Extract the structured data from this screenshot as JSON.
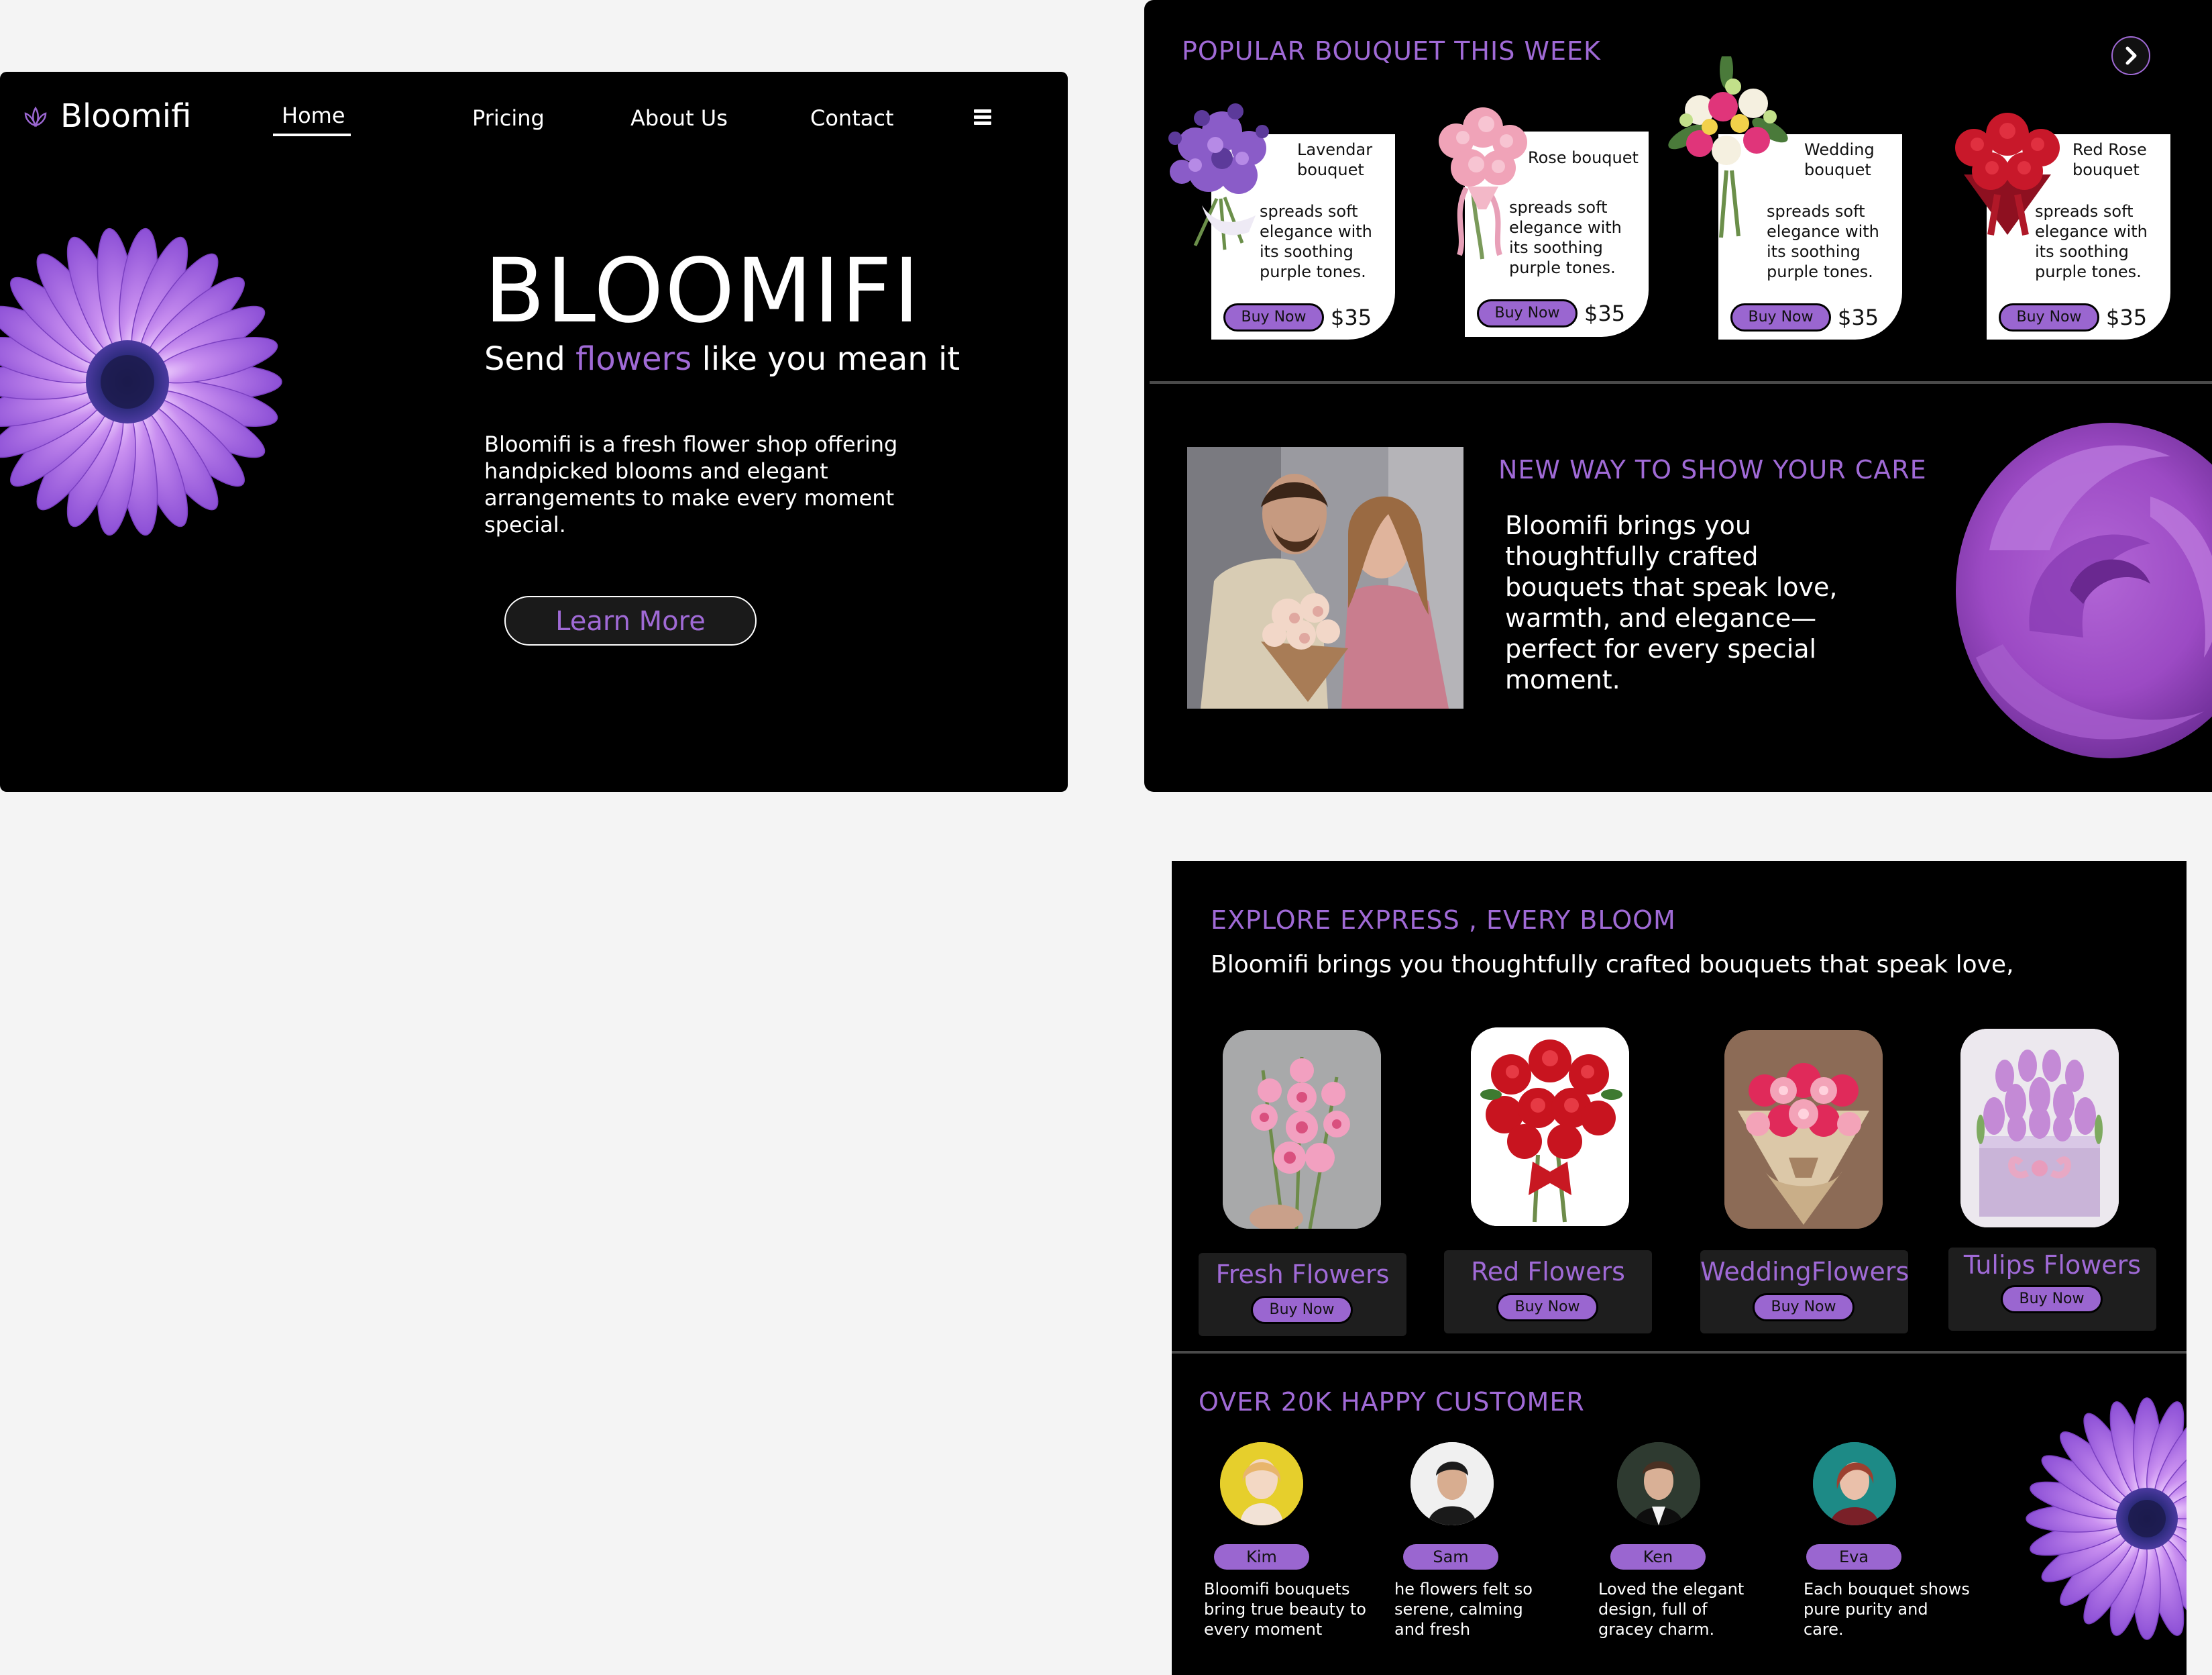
{
  "hero": {
    "logo_text": "Bloomifi",
    "nav": {
      "home": "Home",
      "pricing": "Pricing",
      "about": "About Us",
      "contact": "Contact"
    },
    "title": "BLOOMIFI",
    "subtitle_before": "Send ",
    "subtitle_highlight": "flowers",
    "subtitle_after": " like you mean it",
    "description": "Bloomifi is a fresh flower shop offering handpicked blooms and elegant arrangements to make every moment special.",
    "cta": "Learn More"
  },
  "popular": {
    "title": "POPULAR BOUQUET THIS WEEK",
    "cards": [
      {
        "name": "Lavendar bouquet",
        "desc": "spreads soft elegance with its soothing purple tones.",
        "buy": "Buy Now",
        "price": "$35"
      },
      {
        "name": "Rose bouquet",
        "desc": "spreads soft elegance with its soothing purple tones.",
        "buy": "Buy Now",
        "price": "$35"
      },
      {
        "name": "Wedding bouquet",
        "desc": "spreads soft elegance with its soothing purple tones.",
        "buy": "Buy Now",
        "price": "$35"
      },
      {
        "name": "Red Rose bouquet",
        "desc": "spreads soft elegance with its soothing purple tones.",
        "buy": "Buy Now",
        "price": "$35"
      }
    ]
  },
  "care": {
    "title": "NEW WAY TO SHOW YOUR CARE",
    "description": "Bloomifi brings you thoughtfully crafted bouquets that speak love, warmth, and elegance—perfect for every special moment."
  },
  "explore": {
    "title": "EXPLORE EXPRESS , EVERY BLOOM",
    "subtitle": "Bloomifi brings you thoughtfully crafted bouquets that speak love,",
    "categories": [
      {
        "name": "Fresh Flowers",
        "buy": "Buy Now"
      },
      {
        "name": "Red Flowers",
        "buy": "Buy Now"
      },
      {
        "name": "WeddingFlowers",
        "buy": "Buy Now"
      },
      {
        "name": "Tulips Flowers",
        "buy": "Buy Now"
      }
    ]
  },
  "customers": {
    "title": "OVER 20K HAPPY CUSTOMER",
    "items": [
      {
        "name": "Kim",
        "review": "Bloomifi bouquets bring true beauty to every moment"
      },
      {
        "name": "Sam",
        "review": "he flowers felt so serene, calming and fresh"
      },
      {
        "name": "Ken",
        "review": "Loved the elegant design, full of gracey charm."
      },
      {
        "name": "Eva",
        "review": "Each bouquet shows pure purity and care."
      }
    ]
  },
  "colors": {
    "accent": "#a06ad6",
    "button": "#9a66d0",
    "panel": "#000000",
    "page": "#f4f4f4"
  },
  "icons": {
    "logo": "lotus-icon",
    "menu": "hamburger-icon",
    "next": "chevron-right-icon"
  }
}
